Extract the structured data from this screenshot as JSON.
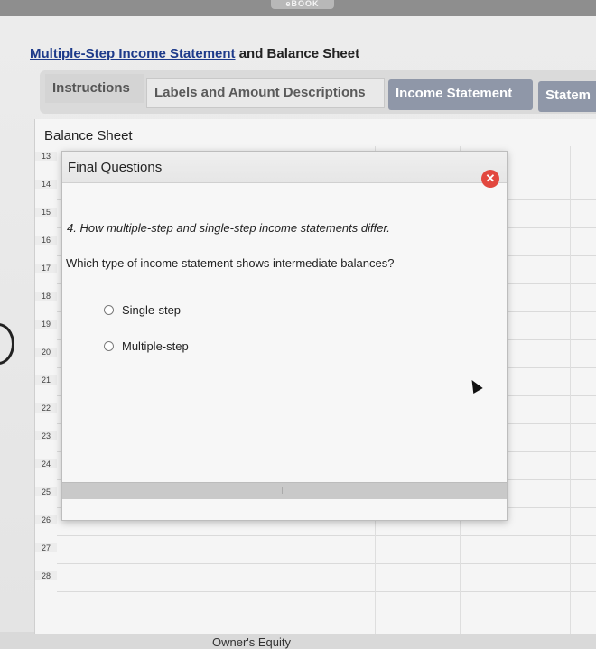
{
  "topbar": {
    "ebook_label": "eBOOK"
  },
  "title": {
    "link_text": "Multiple-Step Income Statement",
    "rest_text": " and Balance Sheet"
  },
  "tabs": [
    {
      "label": "Instructions"
    },
    {
      "label": "Labels and Amount Descriptions"
    },
    {
      "label": "Income Statement"
    },
    {
      "label": "Statem"
    }
  ],
  "sheet": {
    "title": "Balance Sheet",
    "row_numbers": [
      "13",
      "14",
      "15",
      "16",
      "17",
      "18",
      "19",
      "20",
      "21",
      "22",
      "23",
      "24",
      "25",
      "26",
      "27",
      "28"
    ],
    "owners_equity": "Owner's Equity"
  },
  "modal": {
    "title": "Final Questions",
    "close_symbol": "✕",
    "question": "4. How multiple-step and single-step income statements differ.",
    "prompt": "Which type of income statement shows intermediate balances?",
    "options": [
      "Single-step",
      "Multiple-step"
    ]
  },
  "colors": {
    "close_button": "#e2483f",
    "active_tab": "#8f97a8",
    "title_link": "#1d3a8a"
  }
}
